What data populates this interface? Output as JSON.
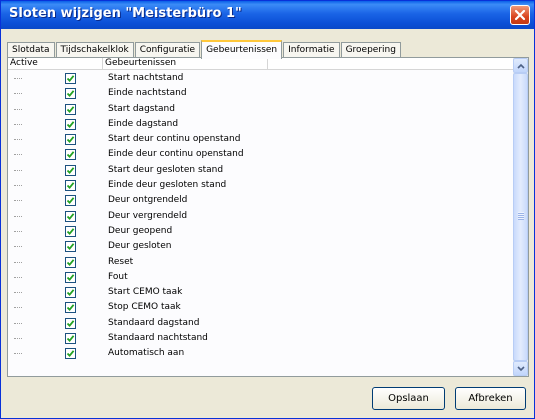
{
  "window": {
    "title": "Sloten wijzigen \"Meisterbüro 1\""
  },
  "tabs": [
    {
      "label": "Slotdata"
    },
    {
      "label": "Tijdschakelklok"
    },
    {
      "label": "Configuratie"
    },
    {
      "label": "Gebeurtenissen",
      "active": true
    },
    {
      "label": "Informatie"
    },
    {
      "label": "Groepering"
    }
  ],
  "table": {
    "columns": [
      "Active",
      "Gebeurtenissen"
    ],
    "rows": [
      {
        "checked": true,
        "label": "Start nachtstand"
      },
      {
        "checked": true,
        "label": "Einde nachtstand"
      },
      {
        "checked": true,
        "label": "Start dagstand"
      },
      {
        "checked": true,
        "label": "Einde dagstand"
      },
      {
        "checked": true,
        "label": "Start deur continu openstand"
      },
      {
        "checked": true,
        "label": "Einde deur continu openstand"
      },
      {
        "checked": true,
        "label": "Start deur gesloten stand"
      },
      {
        "checked": true,
        "label": "Einde deur gesloten stand"
      },
      {
        "checked": true,
        "label": "Deur ontgrendeld"
      },
      {
        "checked": true,
        "label": "Deur vergrendeld"
      },
      {
        "checked": true,
        "label": "Deur geopend"
      },
      {
        "checked": true,
        "label": "Deur gesloten"
      },
      {
        "checked": true,
        "label": "Reset"
      },
      {
        "checked": true,
        "label": "Fout"
      },
      {
        "checked": true,
        "label": "Start CEMO taak"
      },
      {
        "checked": true,
        "label": "Stop CEMO taak"
      },
      {
        "checked": true,
        "label": "Standaard dagstand"
      },
      {
        "checked": true,
        "label": "Standaard nachtstand"
      },
      {
        "checked": true,
        "label": "Automatisch aan"
      }
    ]
  },
  "buttons": {
    "save": "Opslaan",
    "cancel": "Afbreken"
  },
  "colors": {
    "title_bar": "#0a55e0",
    "close_button": "#d9431e",
    "check_mark": "#21a121",
    "active_tab_accent": "#ffc83c"
  }
}
